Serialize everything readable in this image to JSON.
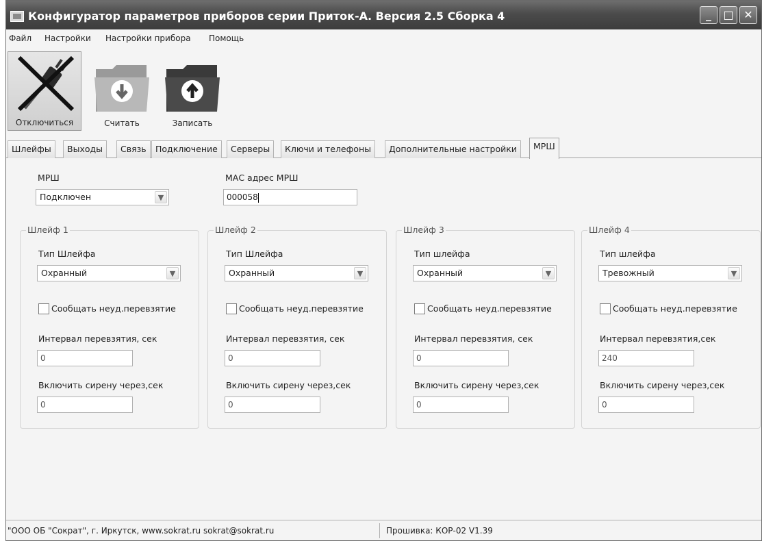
{
  "window": {
    "title": "Конфигуратор параметров приборов серии Приток-А. Версия 2.5 Сборка 4",
    "controls": {
      "minimize": "_",
      "maximize": "□",
      "close": "✕"
    }
  },
  "menu": [
    "Файл",
    "Настройки",
    "Настройки прибора",
    "Помощь"
  ],
  "toolbar": {
    "disconnect_label": "Отключиться",
    "read_label": "Считать",
    "write_label": "Записать"
  },
  "tabs": [
    "Шлейфы",
    "Выходы",
    "Связь",
    "Подключение",
    "Серверы",
    "Ключи и телефоны",
    "Дополнительные настройки",
    "МРШ"
  ],
  "active_tab": "МРШ",
  "mrsh": {
    "label": "МРШ",
    "value": "Подключен",
    "mac_label": "МАС адрес МРШ",
    "mac_value": "000058"
  },
  "loops": [
    {
      "title": "Шлейф 1",
      "type_label": "Тип Шлейфа",
      "type_value": "Охранный",
      "report_label": "Сообщать неуд.перевзятие",
      "report_checked": false,
      "interval_label": "Интервал перевзятия, сек",
      "interval_value": "0",
      "siren_label": "Включить сирену через,сек",
      "siren_value": "0"
    },
    {
      "title": "Шлейф 2",
      "type_label": "Тип Шлейфа",
      "type_value": "Охранный",
      "report_label": "Сообщать неуд.перевзятие",
      "report_checked": false,
      "interval_label": "Интервал перевзятия, сек",
      "interval_value": "0",
      "siren_label": "Включить сирену через,сек",
      "siren_value": "0"
    },
    {
      "title": "Шлейф 3",
      "type_label": "Тип шлейфа",
      "type_value": "Охранный",
      "report_label": "Сообщать неуд.перевзятие",
      "report_checked": false,
      "interval_label": "Интервал перевзятия, сек",
      "interval_value": "0",
      "siren_label": "Включить сирену через,сек",
      "siren_value": "0"
    },
    {
      "title": "Шлейф 4",
      "type_label": "Тип шлейфа",
      "type_value": "Тревожный",
      "report_label": "Сообщать неуд.перевзятие",
      "report_checked": false,
      "interval_label": "Интервал перевзятия,сек",
      "interval_value": "240",
      "siren_label": "Включить сирену через,сек",
      "siren_value": "0"
    }
  ],
  "status": {
    "company": "\"ООО ОБ \"Сократ\", г. Иркутск,    www.sokrat.ru   sokrat@sokrat.ru",
    "firmware": "Прошивка: КОР-02 V1.39"
  }
}
